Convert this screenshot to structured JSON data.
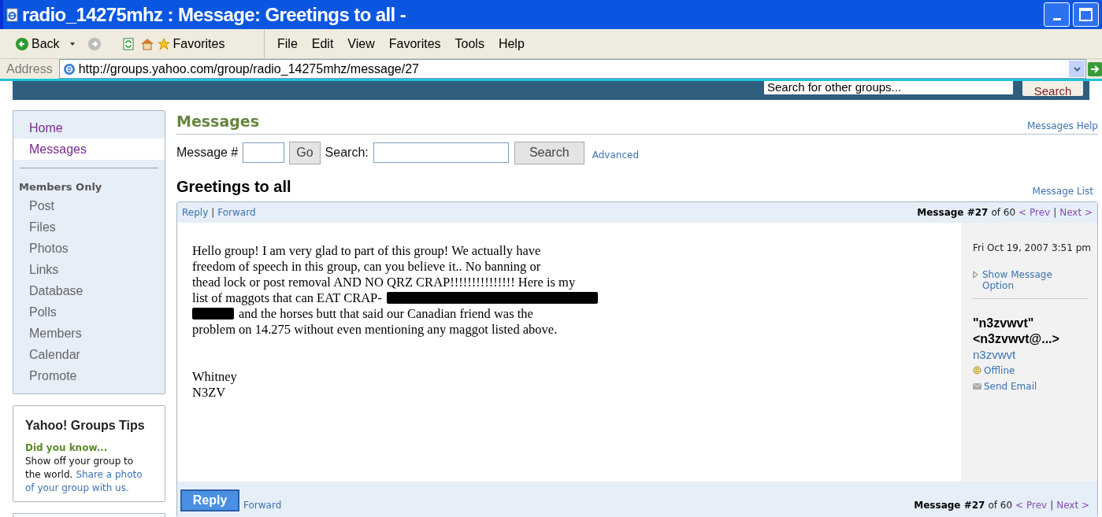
{
  "window": {
    "title": "radio_14275mhz : Message: Greetings to all -"
  },
  "toolbar": {
    "back": "Back",
    "favorites": "Favorites",
    "menu": [
      "File",
      "Edit",
      "View",
      "Favorites",
      "Tools",
      "Help"
    ]
  },
  "address_bar": {
    "label": "Address",
    "url": "http://groups.yahoo.com/group/radio_14275mhz/message/27"
  },
  "group_header": {
    "search_placeholder": "Search for other groups...",
    "search_button": "Search"
  },
  "sidebar": {
    "items": [
      {
        "label": "Home",
        "selected": false
      },
      {
        "label": "Messages",
        "selected": true
      }
    ],
    "section": "Members Only",
    "member_items": [
      "Post",
      "Files",
      "Photos",
      "Links",
      "Database",
      "Polls",
      "Members",
      "Calendar",
      "Promote"
    ]
  },
  "tips": {
    "title": "Yahoo! Groups Tips",
    "subtitle": "Did you know...",
    "lines": [
      [
        {
          "kind": "text",
          "text": "Show off your group to"
        }
      ],
      [
        {
          "kind": "text",
          "text": "the world."
        },
        {
          "kind": "link",
          "text": "Share a photo"
        }
      ],
      [
        {
          "kind": "link",
          "text": "of your group with us."
        }
      ]
    ]
  },
  "messages": {
    "heading": "Messages",
    "help": "Messages Help",
    "number_label": "Message #",
    "go": "Go",
    "search_label": "Search:",
    "search_button": "Search",
    "advanced": "Advanced"
  },
  "message": {
    "subject": "Greetings to all",
    "list_link": "Message List",
    "actions": [
      "Reply",
      "Forward"
    ],
    "actions_separator": "|",
    "top_nav": {
      "number": "Message #27",
      "of": "of 60",
      "prev": "< Prev",
      "separator": "|",
      "next": "Next >"
    },
    "bottom_nav": {
      "number": "Message #27",
      "of": "of 60",
      "prev": "< Prev",
      "separator": "|",
      "next": "Next >"
    },
    "body": [
      [
        {
          "kind": "text",
          "text": "Hello group! I am very glad to part of this group! We actually have"
        }
      ],
      [
        {
          "kind": "text",
          "text": "freedom of speech in this group, can you believe it.. No banning or"
        }
      ],
      [
        {
          "kind": "text",
          "text": "thead lock or post removal AND NO QRZ CRAP!!!!!!!!!!!!!!! Here is my"
        }
      ],
      [
        {
          "kind": "text",
          "text": "list of maggots that can EAT CRAP-"
        },
        {
          "kind": "redaction"
        }
      ],
      [
        {
          "kind": "redaction"
        },
        {
          "kind": "text",
          "text": "and the horses butt that said our Canadian friend was the"
        }
      ],
      [
        {
          "kind": "text",
          "text": "problem on 14.275 without even mentioning any maggot listed above."
        }
      ]
    ],
    "signature": [
      "Whitney",
      "N3ZV"
    ],
    "date": "Fri Oct 19, 2007 3:51 pm",
    "show_option": "Show Message Option",
    "author": "\"n3zvwvt\"",
    "email": "<n3zvwvt@...>",
    "user_id": "n3zvwvt",
    "status": "Offline",
    "send_email": "Send Email",
    "reply_button": "Reply",
    "forward_link": "Forward"
  }
}
